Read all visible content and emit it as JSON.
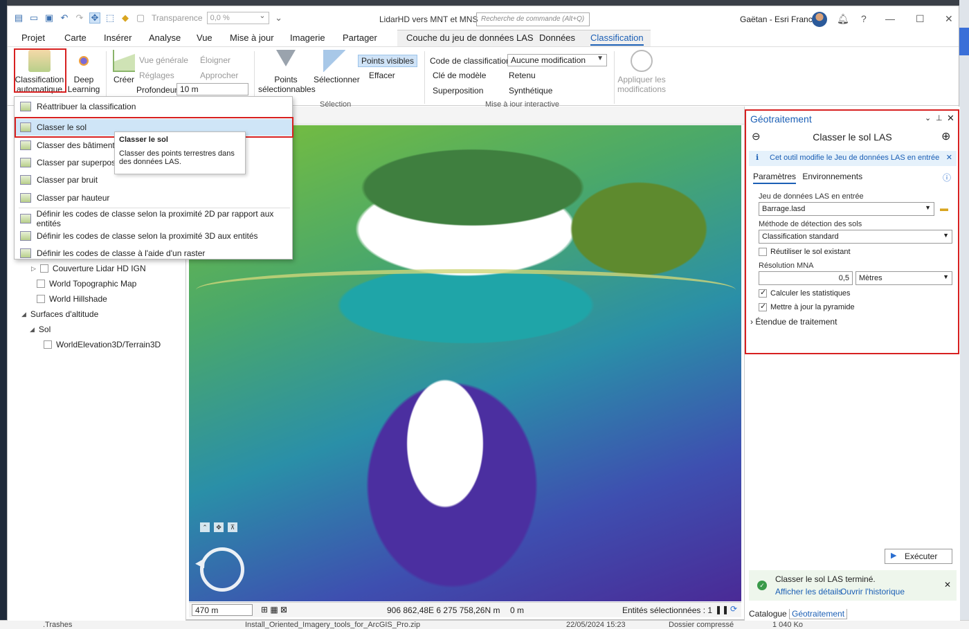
{
  "window": {
    "title": "LidarHD vers MNT et MNS",
    "search_placeholder": "Recherche de commande (Alt+Q)",
    "user": "Gaëtan - Esri France",
    "transparency_label": "Transparence",
    "transparency_value": "0,0 %"
  },
  "tabs": [
    "Projet",
    "Carte",
    "Insérer",
    "Analyse",
    "Vue",
    "Mise à jour",
    "Imagerie",
    "Partager",
    "Couche du jeu de données LAS",
    "Données",
    "Classification"
  ],
  "ribbon": {
    "auto_class_1": "Classification",
    "auto_class_2": "automatique",
    "deep_1": "Deep",
    "deep_2": "Learning",
    "create": "Créer",
    "overview": "Vue générale",
    "settings": "Réglages",
    "zoom_out": "Éloigner",
    "zoom_in": "Approcher",
    "depth_label": "Profondeur",
    "depth_value": "10 m",
    "selectable_1": "Points",
    "selectable_2": "sélectionnables",
    "select": "Sélectionner",
    "visible_points": "Points visibles",
    "erase": "Effacer",
    "selection_group": "Sélection",
    "class_code_label": "Code de classification",
    "class_code_value": "Aucune modification",
    "model_key": "Clé de modèle",
    "withheld": "Retenu",
    "overlap": "Superposition",
    "synthetic": "Synthétique",
    "interactive_group": "Mise à jour interactive",
    "apply_1": "Appliquer les",
    "apply_2": "modifications"
  },
  "menu": {
    "items": [
      "Réattribuer la classification",
      "Classer le sol",
      "Classer des bâtiments",
      "Classer par superpositio",
      "Classer par bruit",
      "Classer par hauteur",
      "Définir les codes de classe selon la proximité 2D par rapport aux entités",
      "Définir les codes de classe selon la proximité 3D aux entités",
      "Définir les codes de classe à l'aide d'un raster"
    ]
  },
  "tooltip": {
    "title": "Classer le sol",
    "body": "Classer des points terrestres dans des données LAS."
  },
  "contents": {
    "items": [
      "Couverture Lidar HD IGN",
      "World Topographic Map",
      "World Hillshade",
      "Surfaces d'altitude",
      "Sol",
      "WorldElevation3D/Terrain3D"
    ]
  },
  "status": {
    "scale": "470 m",
    "coords": "906 862,48E 6 275 758,26N m",
    "elevation": "0 m",
    "selected": "Entités sélectionnées : 1"
  },
  "gp": {
    "title": "Géotraitement",
    "tool": "Classer le sol LAS",
    "info": "Cet outil modifie le Jeu de données LAS en entrée",
    "tab_params": "Paramètres",
    "tab_env": "Environnements",
    "las_label": "Jeu de données LAS en entrée",
    "las_value": "Barrage.lasd",
    "method_label": "Méthode de détection des sols",
    "method_value": "Classification standard",
    "reuse_label": "Réutiliser le sol existant",
    "dem_label": "Résolution MNA",
    "dem_value": "0,5",
    "dem_unit": "Mètres",
    "stats_label": "Calculer les statistiques",
    "pyramid_label": "Mettre à jour la pyramide",
    "extent_label": "Étendue de traitement",
    "run": "Exécuter",
    "done_msg": "Classer le sol LAS terminé.",
    "details": "Afficher les détails",
    "history": "Ouvrir l'historique",
    "catalog_tab": "Catalogue",
    "gp_tab": "Géotraitement"
  },
  "desktop_bottom": {
    "folder": ".Trashes",
    "file": "Install_Oriented_Imagery_tools_for_ArcGIS_Pro.zip",
    "date": "22/05/2024 15:23",
    "type": "Dossier compressé",
    "size": "1 040 Ko"
  },
  "colors": {
    "accent": "#1b5fb5",
    "highlight": "#d72020",
    "menu_hover": "#cfe5f7"
  }
}
